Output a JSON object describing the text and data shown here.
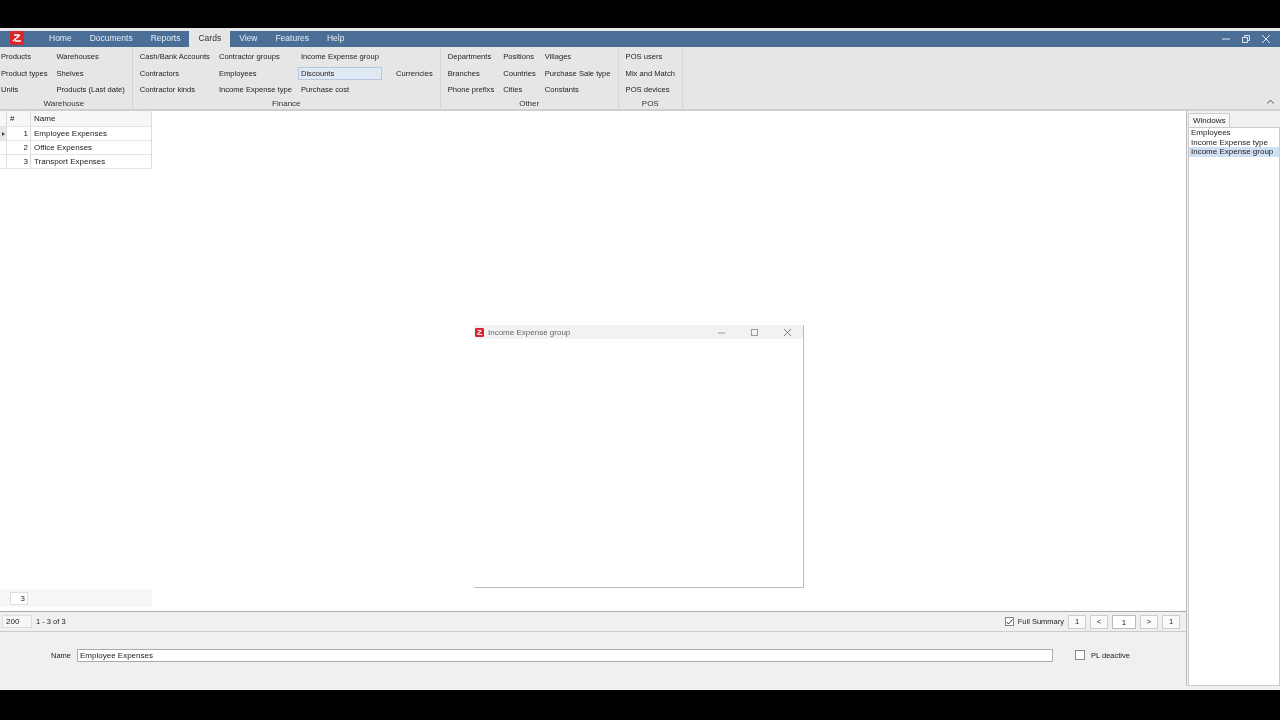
{
  "menu": [
    {
      "label": "Home",
      "selected": false
    },
    {
      "label": "Documents",
      "selected": false
    },
    {
      "label": "Reports",
      "selected": false
    },
    {
      "label": "Cards",
      "selected": true
    },
    {
      "label": "View",
      "selected": false
    },
    {
      "label": "Features",
      "selected": false
    },
    {
      "label": "Help",
      "selected": false
    }
  ],
  "ribbon": {
    "groups": [
      {
        "title": "Warehouse",
        "columns": [
          [
            {
              "label": "Products",
              "highlighted": false
            },
            {
              "label": "Product types",
              "highlighted": false
            },
            {
              "label": "Units",
              "highlighted": false
            }
          ],
          [
            {
              "label": "Warehouses",
              "highlighted": false
            },
            {
              "label": "Shelves",
              "highlighted": false
            },
            {
              "label": "Products (Last date)",
              "highlighted": false
            }
          ]
        ]
      },
      {
        "title": "Finance",
        "columns": [
          [
            {
              "label": "Cash/Bank Accounts",
              "highlighted": false
            },
            {
              "label": "Contractors",
              "highlighted": false
            },
            {
              "label": "Contractor kinds",
              "highlighted": false
            }
          ],
          [
            {
              "label": "Contractor groups",
              "highlighted": false
            },
            {
              "label": "Employees",
              "highlighted": false
            },
            {
              "label": "Income Expense type",
              "highlighted": false
            }
          ],
          [
            {
              "label": "Income Expense group",
              "highlighted": false
            },
            {
              "label": "Discounts",
              "highlighted": true
            },
            {
              "label": "Purchase cost",
              "highlighted": false
            }
          ],
          [
            {
              "label": "Currencies",
              "highlighted": false
            }
          ]
        ]
      },
      {
        "title": "Other",
        "columns": [
          [
            {
              "label": "Departments",
              "highlighted": false
            },
            {
              "label": "Branches",
              "highlighted": false
            },
            {
              "label": "Phone prefixs",
              "highlighted": false
            }
          ],
          [
            {
              "label": "Positions",
              "highlighted": false
            },
            {
              "label": "Countries",
              "highlighted": false
            },
            {
              "label": "Cities",
              "highlighted": false
            }
          ],
          [
            {
              "label": "Villages",
              "highlighted": false
            },
            {
              "label": "Purchase Sale type",
              "highlighted": false
            },
            {
              "label": "Constants",
              "highlighted": false
            }
          ]
        ]
      },
      {
        "title": "POS",
        "columns": [
          [
            {
              "label": "POS users",
              "highlighted": false
            },
            {
              "label": "Mix and Match",
              "highlighted": false
            },
            {
              "label": "POS devices",
              "highlighted": false
            }
          ]
        ]
      }
    ]
  },
  "grid": {
    "columns": [
      "#",
      "Name"
    ],
    "rows": [
      {
        "number": "1",
        "name": "Employee Expenses",
        "current": true
      },
      {
        "number": "2",
        "name": "Office Expenses",
        "current": false
      },
      {
        "number": "3",
        "name": "Transport Expenses",
        "current": false
      }
    ],
    "summary": "3"
  },
  "dialog": {
    "title": "Income Expense group"
  },
  "pager": {
    "page_size": "200",
    "range": "1 - 3 of 3",
    "full_summary": {
      "label": "Full Summary",
      "checked": true
    },
    "first": "1",
    "prev": "<",
    "page": "1",
    "next": ">",
    "last": "1"
  },
  "form": {
    "name_label": "Name",
    "name_value": "Employee Expenses",
    "deactive": {
      "label": "PL deactive",
      "checked": false
    }
  },
  "windows_panel": {
    "tab": "Windows",
    "items": [
      {
        "label": "Employees",
        "selected": false
      },
      {
        "label": "Income Expense type",
        "selected": false
      },
      {
        "label": "Income Expense group",
        "selected": true
      }
    ]
  }
}
